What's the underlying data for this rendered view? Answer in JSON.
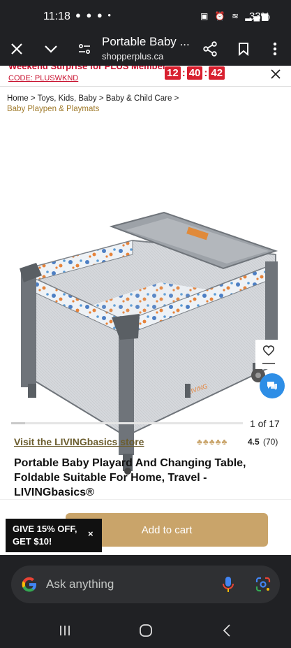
{
  "status_bar": {
    "time": "11:18",
    "battery": "33%"
  },
  "browser": {
    "title": "Portable Baby ...",
    "url": "shopperplus.ca"
  },
  "promo": {
    "text": "Weekend Surprise for PLUS Member",
    "code": "CODE: PLUSWKND",
    "timer": {
      "hours": "12",
      "minutes": "40",
      "seconds": "42"
    }
  },
  "breadcrumb": {
    "items": [
      "Home",
      "Toys, Kids, Baby",
      "Baby & Child Care"
    ],
    "separator": ">",
    "current": "Baby Playpen & Playmats"
  },
  "gallery": {
    "counter": "1 of 17",
    "current": 1,
    "total": 17
  },
  "store": {
    "link": "Visit the LIVINGbasics store",
    "rating": "4.5",
    "reviews": "(70)"
  },
  "product": {
    "title": "Portable Baby Playard And Changing Table, Foldable Suitable For Home, Travel - LIVINGbasics®"
  },
  "actions": {
    "add_to_cart": "Add to cart"
  },
  "discount_popup": {
    "text": "GIVE 15% OFF, GET $10!",
    "close": "×"
  },
  "google_bar": {
    "placeholder": "Ask anything"
  },
  "colors": {
    "accent_gold": "#c9a46a",
    "promo_red": "#d8202f",
    "chat_blue": "#2e8ee6"
  }
}
